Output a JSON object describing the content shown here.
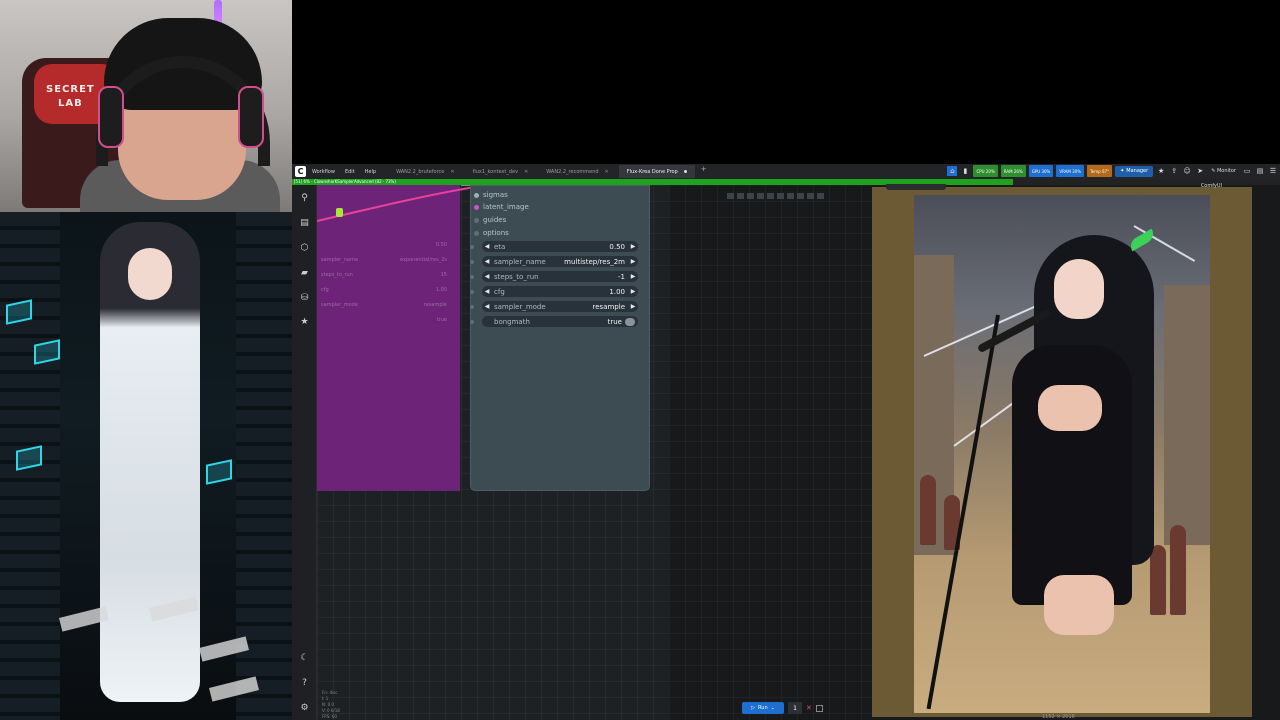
{
  "app": {
    "logo_text": "C",
    "menu": [
      "Workflow",
      "Edit",
      "Help"
    ],
    "tabs": [
      {
        "label": "WAN2.2_bruteforce",
        "active": false
      },
      {
        "label": "flux1_kontext_dev",
        "active": false
      },
      {
        "label": "WAN2.2_recommend",
        "active": false
      },
      {
        "label": "Flux-Krea Done Prop",
        "active": true
      }
    ],
    "add_tab": "+"
  },
  "toolbar_right": {
    "stats": [
      {
        "label": "CPU 20%",
        "color": "#2f8f2f"
      },
      {
        "label": "RAM 26%",
        "color": "#2f8f2f"
      },
      {
        "label": "GPU 30%",
        "color": "#1f6fd0"
      },
      {
        "label": "VRAM 30%",
        "color": "#1f6fd0"
      },
      {
        "label": "Temp 97°",
        "color": "#b56a1a"
      }
    ],
    "manager_label": "Manager",
    "monitor_label": "Monitor"
  },
  "progress": {
    "text": "[51] 6% - ClownsharKSamplerAdvanced (82 · 73%)",
    "percent": 73
  },
  "purple_node": {
    "rows": [
      {
        "label": "",
        "value": "0.50"
      },
      {
        "label": "sampler_name",
        "value": "exponential/res_2s"
      },
      {
        "label": "steps_to_run",
        "value": "15"
      },
      {
        "label": "cfg",
        "value": "1.00"
      },
      {
        "label": "sampler_mode",
        "value": "resample"
      },
      {
        "label": "",
        "value": "true"
      }
    ]
  },
  "node": {
    "inputs": [
      {
        "label": "sigmas",
        "color": "#9bb0b8"
      },
      {
        "label": "latent_image",
        "color": "#d24fd2"
      },
      {
        "label": "guides",
        "color": "#9bb0b8"
      },
      {
        "label": "options",
        "color": "#9bb0b8"
      }
    ],
    "widgets": [
      {
        "label": "eta",
        "value": "0.50",
        "type": "number"
      },
      {
        "label": "sampler_name",
        "value": "multistep/res_2m",
        "type": "combo"
      },
      {
        "label": "steps_to_run",
        "value": "-1",
        "type": "number"
      },
      {
        "label": "cfg",
        "value": "1.00",
        "type": "number"
      },
      {
        "label": "sampler_mode",
        "value": "resample",
        "type": "combo"
      },
      {
        "label": "bongmath",
        "value": "true",
        "type": "toggle"
      }
    ]
  },
  "run": {
    "label": "Run",
    "count": "1"
  },
  "preview": {
    "label": "ComfyUI",
    "caption": "1152 × 2016"
  },
  "status_text": "Fn: disc\nI: 1\nN: 0.0\nV: 0 6/18\nFPS: 60",
  "webcam": {
    "chair_text_1": "SECRET",
    "chair_text_2": "LAB"
  }
}
